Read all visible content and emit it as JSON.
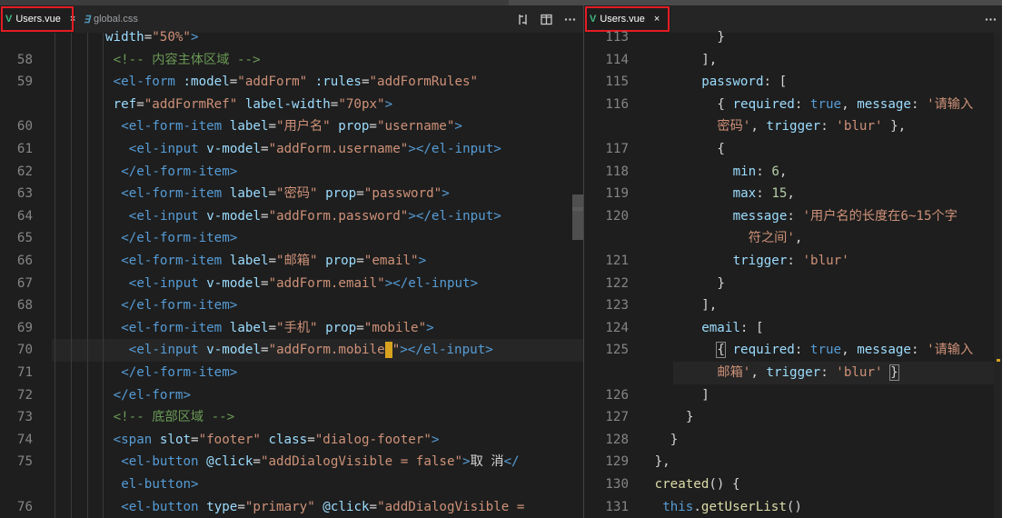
{
  "left": {
    "tabs": [
      {
        "label": "Users.vue",
        "icon": "vue-icon",
        "active": true,
        "close": "×"
      },
      {
        "label": "global.css",
        "icon": "css-icon",
        "active": false
      }
    ],
    "actions": [
      "compare-changes-icon",
      "split-editor-icon",
      "more-actions-icon"
    ],
    "lines": [
      {
        "n": "",
        "indent": 5,
        "tokens": [
          [
            "attr",
            "width"
          ],
          [
            "p",
            "="
          ],
          [
            "str",
            "\"50%\""
          ],
          [
            "tag",
            ">"
          ]
        ]
      },
      {
        "n": "58",
        "indent": 6,
        "tokens": [
          [
            "com",
            "<!-- 内容主体区域 -->"
          ]
        ]
      },
      {
        "n": "59",
        "indent": 6,
        "tokens": [
          [
            "tag",
            "<el-form"
          ],
          [
            "p",
            " "
          ],
          [
            "attr",
            ":model"
          ],
          [
            "p",
            "="
          ],
          [
            "str",
            "\"addForm\""
          ],
          [
            "p",
            " "
          ],
          [
            "attr",
            ":rules"
          ],
          [
            "p",
            "="
          ],
          [
            "str",
            "\"addFormRules\""
          ]
        ]
      },
      {
        "n": "",
        "indent": 6,
        "tokens": [
          [
            "attr",
            "ref"
          ],
          [
            "p",
            "="
          ],
          [
            "str",
            "\"addFormRef\""
          ],
          [
            "p",
            " "
          ],
          [
            "attr",
            "label-width"
          ],
          [
            "p",
            "="
          ],
          [
            "str",
            "\"70px\""
          ],
          [
            "tag",
            ">"
          ]
        ]
      },
      {
        "n": "60",
        "indent": 7,
        "tokens": [
          [
            "tag",
            "<el-form-item"
          ],
          [
            "p",
            " "
          ],
          [
            "attr",
            "label"
          ],
          [
            "p",
            "="
          ],
          [
            "str",
            "\"用户名\""
          ],
          [
            "p",
            " "
          ],
          [
            "attr",
            "prop"
          ],
          [
            "p",
            "="
          ],
          [
            "str",
            "\"username\""
          ],
          [
            "tag",
            ">"
          ]
        ]
      },
      {
        "n": "61",
        "indent": 8,
        "tokens": [
          [
            "tag",
            "<el-input"
          ],
          [
            "p",
            " "
          ],
          [
            "attr",
            "v-model"
          ],
          [
            "p",
            "="
          ],
          [
            "str",
            "\"addForm.username\""
          ],
          [
            "tag",
            "></el-input>"
          ]
        ]
      },
      {
        "n": "62",
        "indent": 7,
        "tokens": [
          [
            "tag",
            "</el-form-item>"
          ]
        ]
      },
      {
        "n": "63",
        "indent": 7,
        "tokens": [
          [
            "tag",
            "<el-form-item"
          ],
          [
            "p",
            " "
          ],
          [
            "attr",
            "label"
          ],
          [
            "p",
            "="
          ],
          [
            "str",
            "\"密码\""
          ],
          [
            "p",
            " "
          ],
          [
            "attr",
            "prop"
          ],
          [
            "p",
            "="
          ],
          [
            "str",
            "\"password\""
          ],
          [
            "tag",
            ">"
          ]
        ]
      },
      {
        "n": "64",
        "indent": 8,
        "tokens": [
          [
            "tag",
            "<el-input"
          ],
          [
            "p",
            " "
          ],
          [
            "attr",
            "v-model"
          ],
          [
            "p",
            "="
          ],
          [
            "str",
            "\"addForm.password\""
          ],
          [
            "tag",
            "></el-input>"
          ]
        ]
      },
      {
        "n": "65",
        "indent": 7,
        "tokens": [
          [
            "tag",
            "</el-form-item>"
          ]
        ]
      },
      {
        "n": "66",
        "indent": 7,
        "tokens": [
          [
            "tag",
            "<el-form-item"
          ],
          [
            "p",
            " "
          ],
          [
            "attr",
            "label"
          ],
          [
            "p",
            "="
          ],
          [
            "str",
            "\"邮箱\""
          ],
          [
            "p",
            " "
          ],
          [
            "attr",
            "prop"
          ],
          [
            "p",
            "="
          ],
          [
            "str",
            "\"email\""
          ],
          [
            "tag",
            ">"
          ]
        ]
      },
      {
        "n": "67",
        "indent": 8,
        "tokens": [
          [
            "tag",
            "<el-input"
          ],
          [
            "p",
            " "
          ],
          [
            "attr",
            "v-model"
          ],
          [
            "p",
            "="
          ],
          [
            "str",
            "\"addForm.email\""
          ],
          [
            "tag",
            "></el-input>"
          ]
        ]
      },
      {
        "n": "68",
        "indent": 7,
        "tokens": [
          [
            "tag",
            "</el-form-item>"
          ]
        ]
      },
      {
        "n": "69",
        "indent": 7,
        "tokens": [
          [
            "tag",
            "<el-form-item"
          ],
          [
            "p",
            " "
          ],
          [
            "attr",
            "label"
          ],
          [
            "p",
            "="
          ],
          [
            "str",
            "\"手机\""
          ],
          [
            "p",
            " "
          ],
          [
            "attr",
            "prop"
          ],
          [
            "p",
            "="
          ],
          [
            "str",
            "\"mobile\""
          ],
          [
            "tag",
            ">"
          ]
        ]
      },
      {
        "n": "70",
        "indent": 8,
        "current": true,
        "tokens": [
          [
            "tag",
            "<el-input"
          ],
          [
            "p",
            " "
          ],
          [
            "attr",
            "v-model"
          ],
          [
            "p",
            "="
          ],
          [
            "str",
            "\"addForm.mobile"
          ],
          [
            "caret",
            ""
          ],
          [
            "str",
            "\""
          ],
          [
            "tag",
            "></el-input>"
          ]
        ]
      },
      {
        "n": "71",
        "indent": 7,
        "tokens": [
          [
            "tag",
            "</el-form-item>"
          ]
        ]
      },
      {
        "n": "72",
        "indent": 6,
        "tokens": [
          [
            "tag",
            "</el-form>"
          ]
        ]
      },
      {
        "n": "73",
        "indent": 6,
        "tokens": [
          [
            "com",
            "<!-- 底部区域 -->"
          ]
        ]
      },
      {
        "n": "74",
        "indent": 6,
        "tokens": [
          [
            "tag",
            "<span"
          ],
          [
            "p",
            " "
          ],
          [
            "attr",
            "slot"
          ],
          [
            "p",
            "="
          ],
          [
            "str",
            "\"footer\""
          ],
          [
            "p",
            " "
          ],
          [
            "attr",
            "class"
          ],
          [
            "p",
            "="
          ],
          [
            "str",
            "\"dialog-footer\""
          ],
          [
            "tag",
            ">"
          ]
        ]
      },
      {
        "n": "75",
        "indent": 7,
        "tokens": [
          [
            "tag",
            "<el-button"
          ],
          [
            "p",
            " "
          ],
          [
            "attr",
            "@click"
          ],
          [
            "p",
            "="
          ],
          [
            "str",
            "\"addDialogVisible = false\""
          ],
          [
            "tag",
            ">"
          ],
          [
            "p",
            "取 消"
          ],
          [
            "tag",
            "</"
          ]
        ]
      },
      {
        "n": "",
        "indent": 7,
        "tokens": [
          [
            "tag",
            "el-button>"
          ]
        ]
      },
      {
        "n": "76",
        "indent": 7,
        "tokens": [
          [
            "tag",
            "<el-button"
          ],
          [
            "p",
            " "
          ],
          [
            "attr",
            "type"
          ],
          [
            "p",
            "="
          ],
          [
            "str",
            "\"primary\""
          ],
          [
            "p",
            " "
          ],
          [
            "attr",
            "@click"
          ],
          [
            "p",
            "="
          ],
          [
            "str",
            "\"addDialogVisible ="
          ]
        ]
      }
    ]
  },
  "right": {
    "tabs": [
      {
        "label": "Users.vue",
        "icon": "vue-icon",
        "active": true,
        "close": "×"
      }
    ],
    "actions": [
      "more-actions-icon"
    ],
    "lines": [
      {
        "n": "113",
        "indent": 9,
        "tokens": [
          [
            "p",
            "}"
          ]
        ]
      },
      {
        "n": "114",
        "indent": 7,
        "tokens": [
          [
            "p",
            "],"
          ]
        ]
      },
      {
        "n": "115",
        "indent": 7,
        "tokens": [
          [
            "key",
            "password"
          ],
          [
            "p",
            ": ["
          ]
        ]
      },
      {
        "n": "116",
        "indent": 9,
        "tokens": [
          [
            "p",
            "{ "
          ],
          [
            "key",
            "required"
          ],
          [
            "p",
            ": "
          ],
          [
            "kw",
            "true"
          ],
          [
            "p",
            ", "
          ],
          [
            "key",
            "message"
          ],
          [
            "p",
            ": "
          ],
          [
            "str",
            "'请输入"
          ]
        ]
      },
      {
        "n": "",
        "indent": 9,
        "tokens": [
          [
            "str",
            "密码'"
          ],
          [
            "p",
            ", "
          ],
          [
            "key",
            "trigger"
          ],
          [
            "p",
            ": "
          ],
          [
            "str",
            "'blur'"
          ],
          [
            "p",
            " },"
          ]
        ]
      },
      {
        "n": "117",
        "indent": 9,
        "tokens": [
          [
            "p",
            "{"
          ]
        ]
      },
      {
        "n": "118",
        "indent": 11,
        "tokens": [
          [
            "key",
            "min"
          ],
          [
            "p",
            ": "
          ],
          [
            "num",
            "6"
          ],
          [
            "p",
            ","
          ]
        ]
      },
      {
        "n": "119",
        "indent": 11,
        "tokens": [
          [
            "key",
            "max"
          ],
          [
            "p",
            ": "
          ],
          [
            "num",
            "15"
          ],
          [
            "p",
            ","
          ]
        ]
      },
      {
        "n": "120",
        "indent": 11,
        "tokens": [
          [
            "key",
            "message"
          ],
          [
            "p",
            ": "
          ],
          [
            "str",
            "'用户名的长度在6~15个字"
          ]
        ]
      },
      {
        "n": "",
        "indent": 13,
        "tokens": [
          [
            "str",
            "符之间'"
          ],
          [
            "p",
            ","
          ]
        ]
      },
      {
        "n": "121",
        "indent": 11,
        "tokens": [
          [
            "key",
            "trigger"
          ],
          [
            "p",
            ": "
          ],
          [
            "str",
            "'blur'"
          ]
        ]
      },
      {
        "n": "122",
        "indent": 9,
        "tokens": [
          [
            "p",
            "}"
          ]
        ]
      },
      {
        "n": "123",
        "indent": 7,
        "tokens": [
          [
            "p",
            "],"
          ]
        ]
      },
      {
        "n": "124",
        "indent": 7,
        "tokens": [
          [
            "key",
            "email"
          ],
          [
            "p",
            ": ["
          ]
        ]
      },
      {
        "n": "125",
        "indent": 9,
        "tokens": [
          [
            "br",
            "{"
          ],
          [
            "p",
            " "
          ],
          [
            "key",
            "required"
          ],
          [
            "p",
            ": "
          ],
          [
            "kw",
            "true"
          ],
          [
            "p",
            ", "
          ],
          [
            "key",
            "message"
          ],
          [
            "p",
            ": "
          ],
          [
            "str",
            "'请输入"
          ]
        ]
      },
      {
        "n": "",
        "indent": 9,
        "current": true,
        "tokens": [
          [
            "str",
            "邮箱'"
          ],
          [
            "p",
            ", "
          ],
          [
            "key",
            "trigger"
          ],
          [
            "p",
            ": "
          ],
          [
            "str",
            "'blur'"
          ],
          [
            "p",
            " "
          ],
          [
            "br",
            "}"
          ]
        ]
      },
      {
        "n": "126",
        "indent": 7,
        "tokens": [
          [
            "p",
            "]"
          ]
        ]
      },
      {
        "n": "127",
        "indent": 5,
        "tokens": [
          [
            "p",
            "}"
          ]
        ]
      },
      {
        "n": "128",
        "indent": 3,
        "tokens": [
          [
            "p",
            "}"
          ]
        ]
      },
      {
        "n": "129",
        "indent": 1,
        "tokens": [
          [
            "p",
            "},"
          ]
        ]
      },
      {
        "n": "130",
        "indent": 1,
        "tokens": [
          [
            "fn",
            "created"
          ],
          [
            "p",
            "() {"
          ]
        ]
      },
      {
        "n": "131",
        "indent": 2,
        "tokens": [
          [
            "kw",
            "this"
          ],
          [
            "p",
            "."
          ],
          [
            "fn",
            "getUserList"
          ],
          [
            "p",
            "()"
          ]
        ]
      }
    ]
  }
}
